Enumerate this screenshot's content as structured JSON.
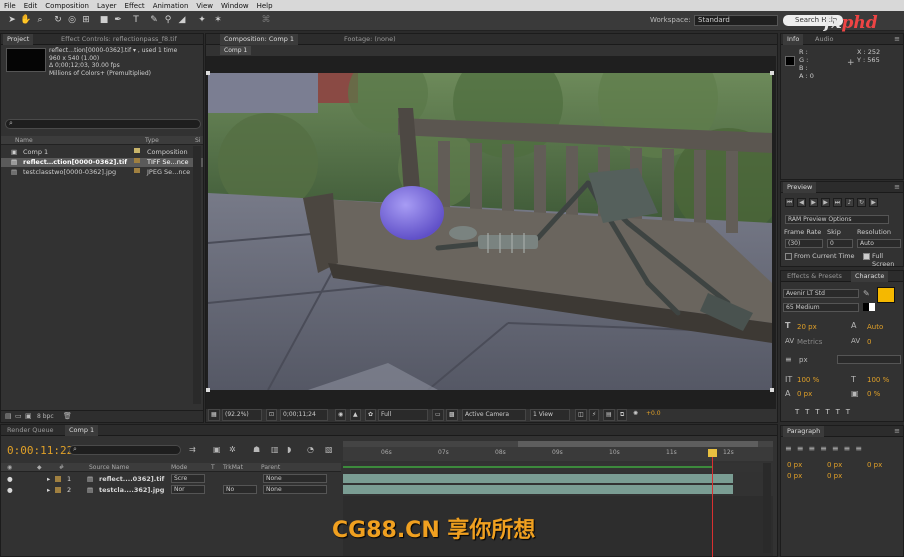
{
  "menu": [
    "File",
    "Edit",
    "Composition",
    "Layer",
    "Effect",
    "Animation",
    "View",
    "Window",
    "Help"
  ],
  "toolbar": {
    "workspace_label": "Workspace:",
    "workspace_value": "Standard",
    "search_placeholder": "Search Help"
  },
  "logo": {
    "a": "fx",
    "b": "phd"
  },
  "project": {
    "tab_project": "Project",
    "tab_effects": "Effect Controls: reflectionpass_f8.tif",
    "info_name": "reflect…tion[0000-0362].tif ▾ , used 1 time",
    "info_dims": "960 x 540 (1.00)",
    "info_duration": "Δ 0;00;12;03, 30.00 fps",
    "info_colors": "Millions of Colors+ (Premultiplied)",
    "col_name": "Name",
    "col_type": "Type",
    "col_size": "Si",
    "items": [
      {
        "name": "Comp 1",
        "type": "Composition",
        "color": "#c8b46a"
      },
      {
        "name": "reflect…ction[0000-0362].tif",
        "type": "TIFF Se...nce",
        "color": "#a08040"
      },
      {
        "name": "testclasstwo[0000-0362].jpg",
        "type": "JPEG Se...nce",
        "color": "#a08040"
      }
    ],
    "bpc": "8 bpc"
  },
  "comp": {
    "tab_comp": "Composition: Comp 1",
    "tab_footage": "Footage: (none)",
    "crumb": "Comp 1",
    "zoom": "(92.2%)",
    "timecode": "0;00;11;24",
    "resolution": "Full",
    "camera": "Active Camera",
    "views": "1 View",
    "exposure": "+0.0"
  },
  "timeline": {
    "tab_render": "Render Queue",
    "tab_comp": "Comp 1",
    "timecode": "0:00:11:22",
    "col_source": "Source Name",
    "col_mode": "Mode",
    "col_t": "T",
    "col_trkmat": "TrkMat",
    "col_parent": "Parent",
    "ticks": [
      "06s",
      "07s",
      "08s",
      "09s",
      "10s",
      "11s",
      "12s"
    ],
    "layers": [
      {
        "num": "1",
        "name": "reflect....0362].tif",
        "mode": "Scre",
        "trkmat": "",
        "parent": "None"
      },
      {
        "num": "2",
        "name": "testcla....362].jpg",
        "mode": "Nor",
        "trkmat": "No",
        "parent": "None"
      }
    ]
  },
  "info": {
    "tab_info": "Info",
    "tab_audio": "Audio",
    "r": "R :",
    "g": "G :",
    "b": "B :",
    "a": "A : 0",
    "x": "X : 252",
    "y": "Y : 565"
  },
  "preview": {
    "tab": "Preview",
    "ram": "RAM Preview Options",
    "frame_rate_label": "Frame Rate",
    "skip_label": "Skip",
    "resolution_label": "Resolution",
    "frame_rate": "(30)",
    "skip": "0",
    "resolution": "Auto",
    "from_current": "From Current Time",
    "full_screen": "Full Screen"
  },
  "character": {
    "tab_effects": "Effects & Presets",
    "tab_char": "Characte",
    "font": "Avenir LT Std",
    "style": "65 Medium",
    "size": "20 px",
    "leading": "Auto",
    "kerning": "Metrics",
    "tracking": "0",
    "stroke": "px",
    "vscale": "100 %",
    "hscale": "100 %",
    "baseline": "0 px",
    "tsume": "0 %",
    "fill_color": "#f5b800"
  },
  "paragraph": {
    "tab": "Paragraph",
    "indent1": "0 px",
    "indent2": "0 px",
    "indent3": "0 px",
    "space1": "0 px",
    "space2": "0 px"
  },
  "watermark": "CG88.CN 享你所想"
}
